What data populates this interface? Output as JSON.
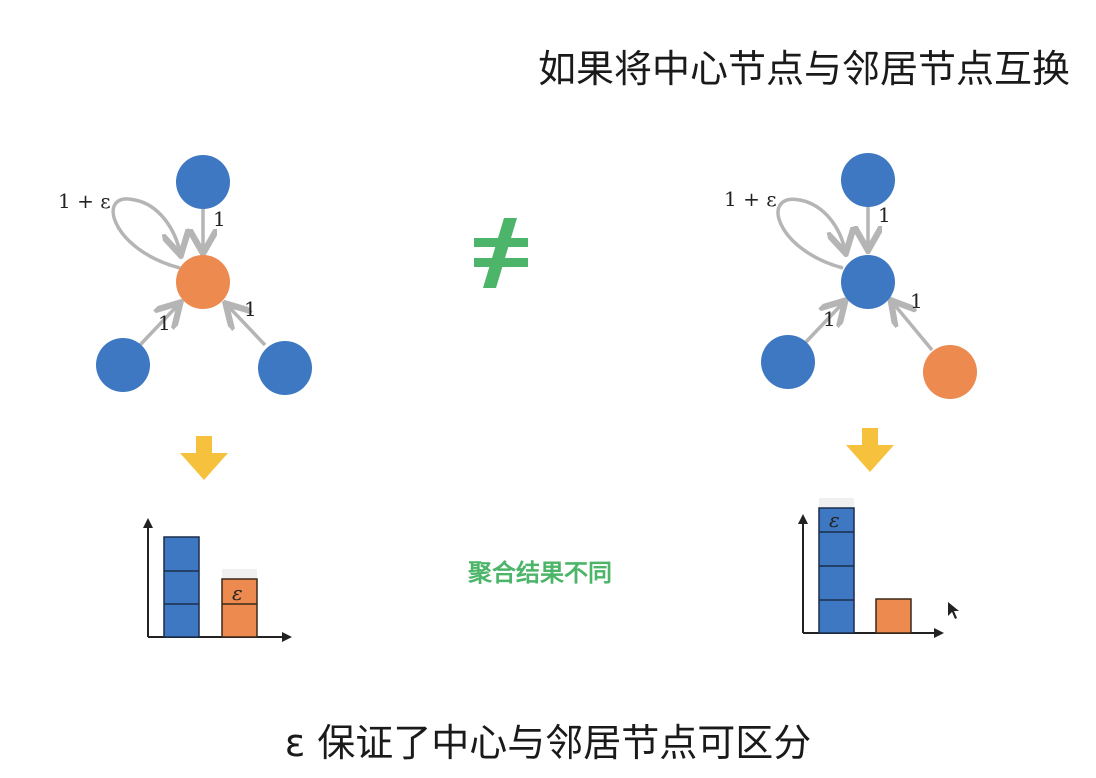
{
  "title": "如果将中心节点与邻居节点互换",
  "not_equal_symbol": "≠",
  "center_caption": "聚合结果不同",
  "footer_caption": "ε 保证了中心与邻居节点可区分",
  "colors": {
    "blue_node": "#3f78c2",
    "orange_node": "#ec8a4f",
    "edge": "#b5b5b5",
    "arrow_down": "#f6c23e",
    "neq": "#4db56a",
    "bar_blue": "#3f78c2",
    "bar_orange": "#ec8a4f"
  },
  "left_graph": {
    "self_loop_label": "1 + ε",
    "edge_top_label": "1",
    "edge_left_label": "1",
    "edge_right_label": "1",
    "center_color": "orange",
    "neighbors": [
      "blue",
      "blue",
      "blue"
    ]
  },
  "right_graph": {
    "self_loop_label": "1 + ε",
    "edge_top_label": "1",
    "edge_left_label": "1",
    "edge_right_label": "1",
    "center_color": "blue",
    "neighbors": [
      "blue",
      "blue",
      "orange"
    ]
  },
  "left_histogram": {
    "blue_count": 3,
    "orange_count": 1,
    "orange_epsilon_label": "ε"
  },
  "right_histogram": {
    "blue_count": 3,
    "orange_count": 1,
    "blue_epsilon_label": "ε"
  }
}
